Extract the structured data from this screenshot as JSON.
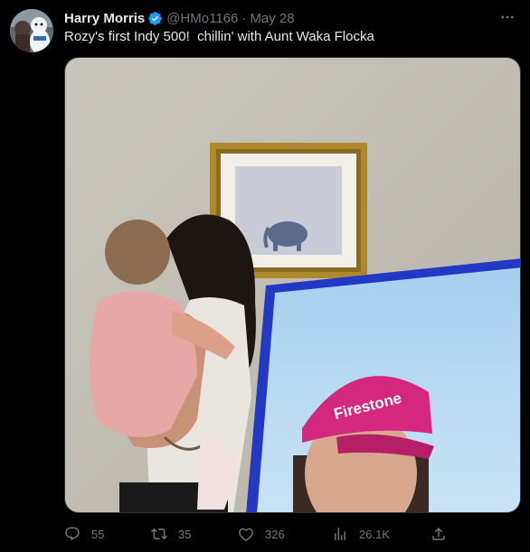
{
  "author": {
    "display_name": "Harry Morris",
    "handle": "@HMo1166",
    "separator": "·",
    "date": "May 28",
    "verified": true
  },
  "tweet": {
    "text": "Rozy's first Indy 500!  chillin' with Aunt Waka Flocka"
  },
  "media": {
    "tv_hat_text": "Firestone"
  },
  "actions": {
    "replies": "55",
    "retweets": "35",
    "likes": "326",
    "views": "26.1K"
  },
  "icons": {
    "verified": "verified-badge-icon",
    "more": "more-options-icon",
    "reply": "reply-icon",
    "retweet": "retweet-icon",
    "like": "heart-icon",
    "views": "views-chart-icon",
    "share": "share-icon"
  },
  "colors": {
    "background": "#000000",
    "text": "#e7e9ea",
    "secondary_text": "#71767b",
    "verified_blue": "#1d9bf0",
    "hat_magenta": "#d4277e"
  }
}
